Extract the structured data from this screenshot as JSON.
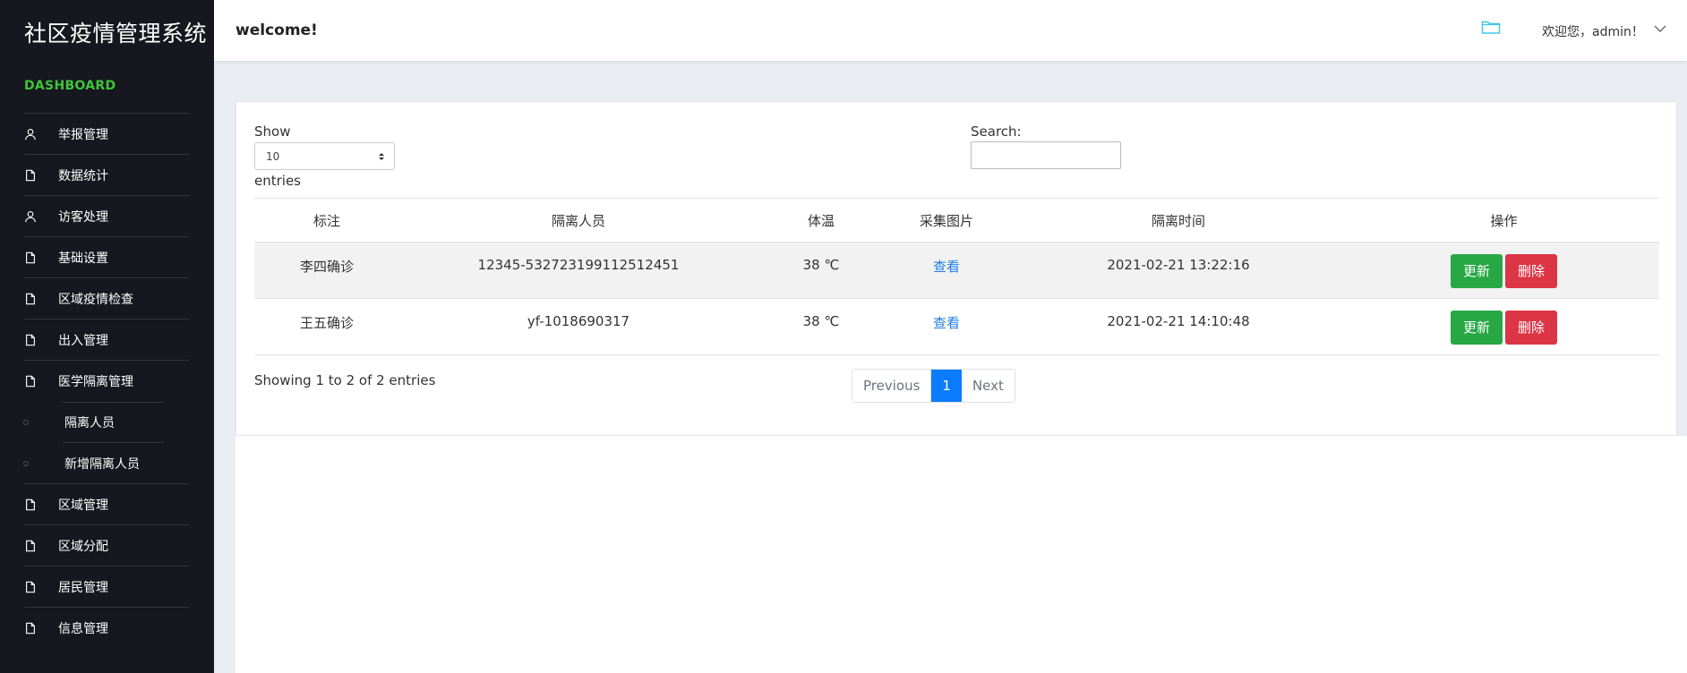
{
  "app": {
    "title": "社区疫情管理系统",
    "section": "DASHBOARD"
  },
  "header": {
    "welcome": "welcome!",
    "user": "欢迎您，admin！"
  },
  "sidebar": {
    "items": [
      {
        "label": "举报管理",
        "icon": "user-icon"
      },
      {
        "label": "数据统计",
        "icon": "file-icon"
      },
      {
        "label": "访客处理",
        "icon": "user-icon"
      },
      {
        "label": "基础设置",
        "icon": "file-icon"
      },
      {
        "label": "区域疫情检查",
        "icon": "file-icon"
      },
      {
        "label": "出入管理",
        "icon": "file-icon"
      },
      {
        "label": "医学隔离管理",
        "icon": "file-icon"
      }
    ],
    "sub_items": [
      {
        "label": "隔离人员"
      },
      {
        "label": "新增隔离人员"
      }
    ],
    "items_after": [
      {
        "label": "区域管理",
        "icon": "file-icon"
      },
      {
        "label": "区域分配",
        "icon": "file-icon"
      },
      {
        "label": "居民管理",
        "icon": "file-icon"
      },
      {
        "label": "信息管理",
        "icon": "file-icon"
      }
    ]
  },
  "table_controls": {
    "show_label": "Show",
    "page_size": "10",
    "entries_label": "entries",
    "search_label": "Search:",
    "search_value": ""
  },
  "table": {
    "columns": [
      "标注",
      "隔离人员",
      "体温",
      "采集图片",
      "隔离时间",
      "操作"
    ],
    "rows": [
      {
        "mark": "李四确诊",
        "person": "12345-532723199112512451",
        "temp": "38 ℃",
        "image_link": "查看",
        "time": "2021-02-21 13:22:16",
        "update": "更新",
        "delete": "删除"
      },
      {
        "mark": "王五确诊",
        "person": "yf-1018690317",
        "temp": "38 ℃",
        "image_link": "查看",
        "time": "2021-02-21 14:10:48",
        "update": "更新",
        "delete": "删除"
      }
    ]
  },
  "footer": {
    "info": "Showing 1 to 2 of 2 entries",
    "prev": "Previous",
    "page": "1",
    "next": "Next"
  },
  "colors": {
    "sidebar_bg": "#16171f",
    "dashboard_green": "#3fc53a",
    "update_green": "#28a745",
    "delete_red": "#dc3545",
    "page_active": "#0b7bff",
    "link_blue": "#1f7ee0"
  }
}
